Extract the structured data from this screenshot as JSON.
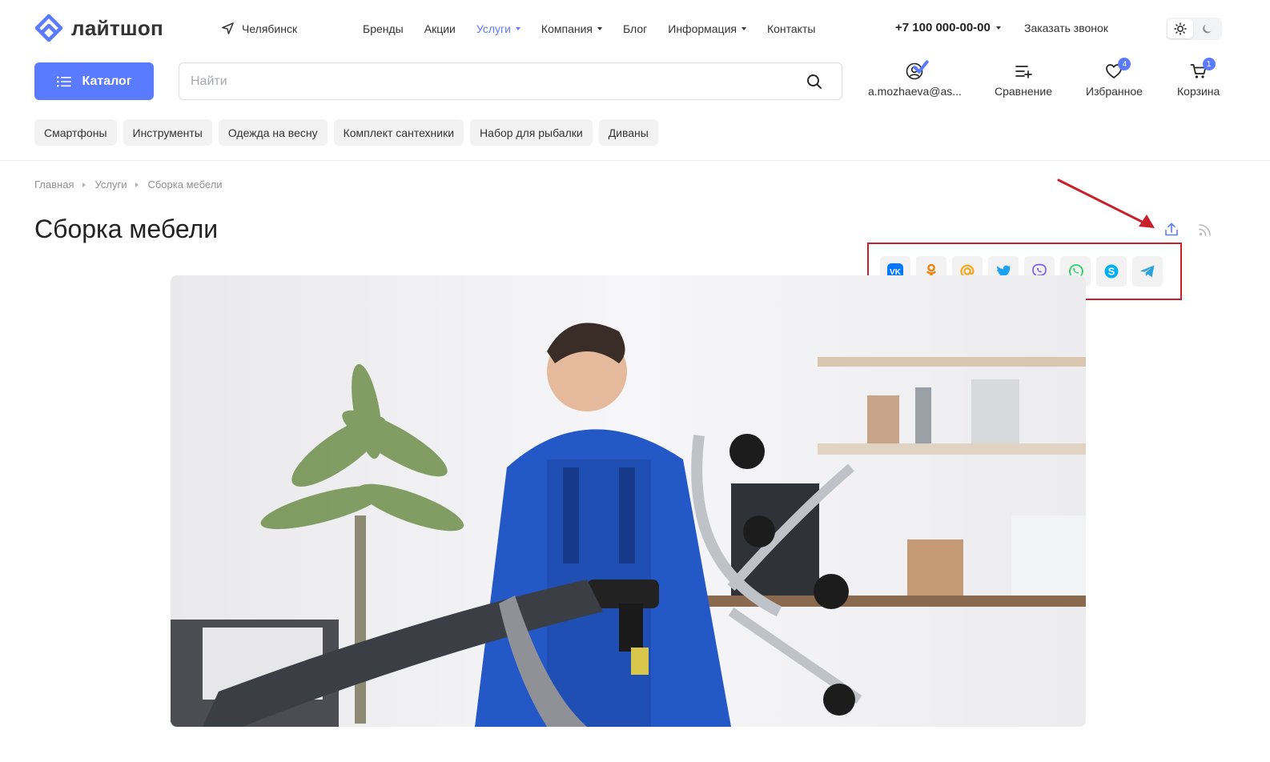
{
  "brand": {
    "name": "лайтшоп",
    "accent_color": "#5a7bff"
  },
  "location": {
    "city": "Челябинск",
    "icon": "navigation-arrow-icon"
  },
  "top_nav": [
    {
      "label": "Бренды",
      "has_dropdown": false,
      "active": false
    },
    {
      "label": "Акции",
      "has_dropdown": false,
      "active": false
    },
    {
      "label": "Услуги",
      "has_dropdown": true,
      "active": true
    },
    {
      "label": "Компания",
      "has_dropdown": true,
      "active": false
    },
    {
      "label": "Блог",
      "has_dropdown": false,
      "active": false
    },
    {
      "label": "Информация",
      "has_dropdown": true,
      "active": false
    },
    {
      "label": "Контакты",
      "has_dropdown": false,
      "active": false
    }
  ],
  "contact": {
    "phone": "+7 100 000-00-00",
    "callback_label": "Заказать звонок"
  },
  "theme": {
    "options": [
      "sun-icon",
      "moon-icon"
    ],
    "selected": "light"
  },
  "catalog": {
    "label": "Каталог"
  },
  "search": {
    "placeholder": "Найти",
    "value": ""
  },
  "header_actions": {
    "account": {
      "label": "a.mozhaeva@as...",
      "icon": "user-icon"
    },
    "compare": {
      "label": "Сравнение",
      "icon": "compare-list-icon"
    },
    "favorites": {
      "label": "Избранное",
      "count": "4",
      "icon": "heart-icon"
    },
    "cart": {
      "label": "Корзина",
      "count": "1",
      "icon": "cart-icon"
    }
  },
  "tags": [
    "Смартфоны",
    "Инструменты",
    "Одежда на весну",
    "Комплект сантехники",
    "Набор для рыбалки",
    "Диваны"
  ],
  "breadcrumbs": [
    "Главная",
    "Услуги",
    "Сборка мебели"
  ],
  "page": {
    "title": "Сборка мебели"
  },
  "share": {
    "networks": [
      {
        "name": "vk",
        "icon": "vk-icon",
        "color": "#0077ff"
      },
      {
        "name": "odnoklassniki",
        "icon": "odnoklassniki-icon",
        "color": "#ee8208"
      },
      {
        "name": "mail",
        "icon": "mail-at-icon",
        "color": "#f5a623"
      },
      {
        "name": "twitter",
        "icon": "twitter-icon",
        "color": "#1da1f2"
      },
      {
        "name": "viber",
        "icon": "viber-icon",
        "color": "#7360f2"
      },
      {
        "name": "whatsapp",
        "icon": "whatsapp-icon",
        "color": "#25d366"
      },
      {
        "name": "skype",
        "icon": "skype-icon",
        "color": "#00aff0"
      },
      {
        "name": "telegram",
        "icon": "telegram-icon",
        "color": "#2aa3de"
      }
    ]
  },
  "annotation": {
    "color": "#c8202a"
  }
}
